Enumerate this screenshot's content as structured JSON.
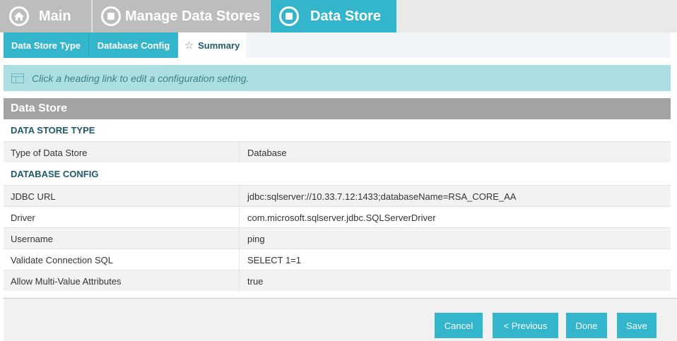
{
  "breadcrumbs": {
    "main": "Main",
    "manage": "Manage Data Stores",
    "store": "Data Store"
  },
  "tabs": {
    "type": "Data Store Type",
    "db": "Database Config",
    "summary": "Summary"
  },
  "banner": {
    "text": "Click a heading link to edit a configuration setting."
  },
  "section": {
    "title": "Data Store",
    "groups": {
      "type": {
        "title": "DATA STORE TYPE",
        "rows": [
          {
            "label": "Type of Data Store",
            "value": "Database"
          }
        ]
      },
      "db": {
        "title": "DATABASE CONFIG",
        "rows": [
          {
            "label": "JDBC URL",
            "value": "jdbc:sqlserver://10.33.7.12:1433;databaseName=RSA_CORE_AA"
          },
          {
            "label": "Driver",
            "value": "com.microsoft.sqlserver.jdbc.SQLServerDriver"
          },
          {
            "label": "Username",
            "value": "ping"
          },
          {
            "label": "Validate Connection SQL",
            "value": "SELECT 1=1"
          },
          {
            "label": "Allow Multi-Value Attributes",
            "value": "true"
          }
        ]
      }
    }
  },
  "buttons": {
    "cancel": "Cancel",
    "previous": "< Previous",
    "done": "Done",
    "save": "Save"
  },
  "icons": {
    "main": "home-icon",
    "manage": "stop-circle-icon",
    "store": "stop-circle-icon",
    "summary": "star-icon",
    "banner": "info-panel-icon"
  },
  "colors": {
    "accent": "#33b5cc",
    "inactive_crumb": "#bdbdbd",
    "section_header": "#a3a3a3",
    "banner": "#abdfe1",
    "heading_text": "#1f5a6b"
  }
}
